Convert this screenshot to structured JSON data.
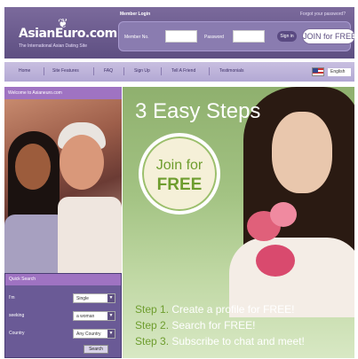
{
  "brand": {
    "name": "AsianEuro.com",
    "tagline": "The International Asian Dating Site"
  },
  "login": {
    "title": "Member Login",
    "forgot": "Forgot your password?",
    "member_label": "Member No.",
    "password_label": "Password",
    "signin_label": "Sign in",
    "join_label": "JOIN for FREE"
  },
  "nav": {
    "items": [
      "Home",
      "Site Features",
      "FAQ",
      "Sign Up",
      "Tell A Friend",
      "Testimonials"
    ],
    "language": "English"
  },
  "welcome": "Welcome to Asianeuro.com",
  "quick_search": {
    "title": "Quick Search",
    "rows": [
      {
        "label": "I'm",
        "value": "Single"
      },
      {
        "label": "seeking",
        "value": "a woman"
      },
      {
        "label": "Country",
        "value": "Any Country"
      }
    ],
    "search_label": "Search"
  },
  "hero": {
    "title": "3 Easy Steps",
    "join_line1": "Join for",
    "join_line2": "FREE",
    "steps": [
      {
        "key": "Step 1.",
        "text": "Create a profile for FREE!"
      },
      {
        "key": "Step 2.",
        "text": "Search for FREE!"
      },
      {
        "key": "Step 3.",
        "text": "Subscribe to chat and meet!"
      }
    ]
  },
  "colors": {
    "header": "#5e4f82",
    "nav": "#b3a8d4",
    "accent_green": "#6e9d2e",
    "welcome_bar": "#9f73c2"
  }
}
